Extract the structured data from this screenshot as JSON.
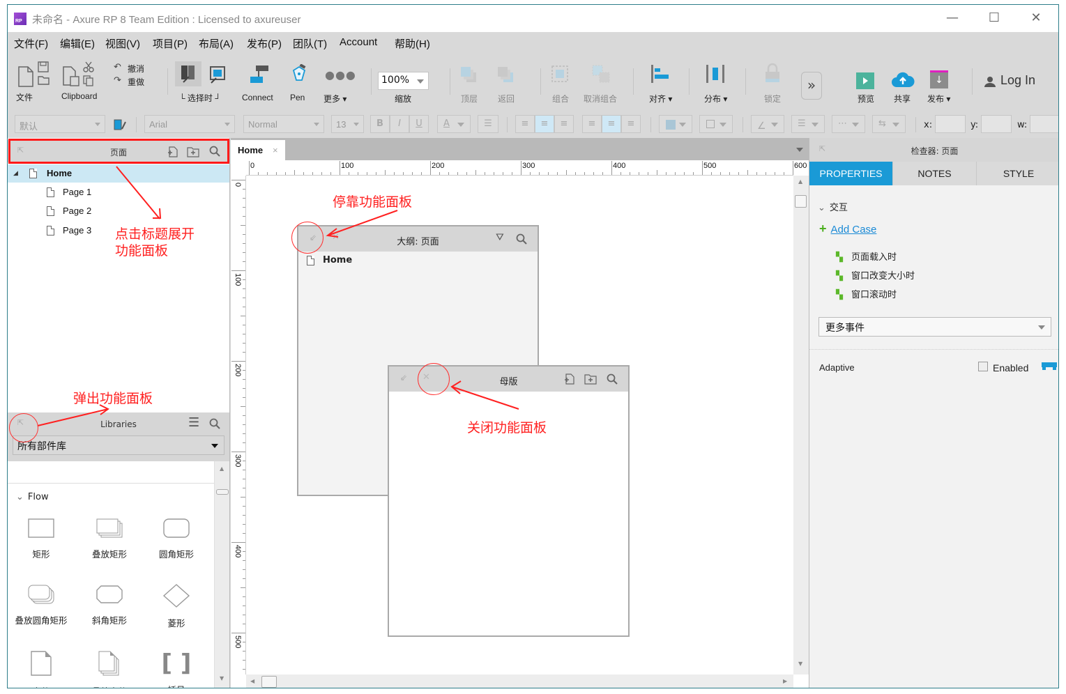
{
  "window": {
    "title": "未命名 - Axure RP 8 Team Edition : Licensed to axureuser",
    "logo_text": "RP",
    "controls": {
      "minimize": "—",
      "maximize": "☐",
      "close": "✕"
    }
  },
  "menu": [
    "文件(F)",
    "编辑(E)",
    "视图(V)",
    "项目(P)",
    "布局(A)",
    "发布(P)",
    "团队(T)",
    "Account",
    "帮助(H)"
  ],
  "toolbar": {
    "file_label": "文件",
    "clipboard_label": "Clipboard",
    "undo_label": "撤消",
    "redo_label": "重做",
    "select_mode_label": "选择时",
    "connect_label": "Connect",
    "pen_label": "Pen",
    "more_label": "更多 ▾",
    "zoom_value": "100%",
    "zoom_label": "缩放",
    "top_label": "顶层",
    "back_label": "返回",
    "group_label": "组合",
    "ungroup_label": "取消组合",
    "align_label": "对齐 ▾",
    "distribute_label": "分布 ▾",
    "lock_label": "锁定",
    "overflow_label": "»",
    "preview_label": "预览",
    "share_label": "共享",
    "publish_label": "发布 ▾",
    "login_label": "Log In",
    "colors": {
      "preview": "#4cb39c",
      "share": "#1a9ad6",
      "publish_bar": "#e020c0",
      "accent": "#1a9ad6"
    }
  },
  "format_bar": {
    "style_value": "默认",
    "font_value": "Arial",
    "weight_value": "Normal",
    "size_value": "13",
    "bold": "B",
    "italic": "I",
    "underline": "U",
    "font_color": "A",
    "x_label": "x:",
    "y_label": "y:",
    "w_label": "w:"
  },
  "pages_panel": {
    "title": "页面",
    "items": [
      {
        "label": "Home",
        "selected": true
      },
      {
        "label": "Page 1"
      },
      {
        "label": "Page 2"
      },
      {
        "label": "Page 3"
      }
    ]
  },
  "libraries_panel": {
    "title": "Libraries",
    "selected_library": "所有部件库",
    "group": "Flow",
    "widgets": [
      "矩形",
      "叠放矩形",
      "圆角矩形",
      "叠放圆角矩形",
      "斜角矩形",
      "菱形",
      "文件",
      "叠放文件",
      "括号"
    ]
  },
  "canvas": {
    "tab_label": "Home",
    "hruler_labels": [
      "0",
      "100",
      "200",
      "300",
      "400",
      "500",
      "600"
    ],
    "vruler_labels": [
      "0",
      "100",
      "200",
      "300",
      "400",
      "500"
    ]
  },
  "outline_panel": {
    "title": "大纲: 页面",
    "items": [
      "Home"
    ]
  },
  "masters_panel": {
    "title": "母版"
  },
  "annotations": {
    "expand": "点击标题展开\n功能面板",
    "expand_line1": "点击标题展开",
    "expand_line2": "功能面板",
    "dock": "停靠功能面板",
    "popout": "弹出功能面板",
    "close": "关闭功能面板",
    "color": "#ff2020"
  },
  "inspector": {
    "title": "检查器: 页面",
    "tabs": [
      "PROPERTIES",
      "NOTES",
      "STYLE"
    ],
    "active_tab": "PROPERTIES",
    "interactions_label": "交互",
    "add_case": "Add Case",
    "events": [
      "页面载入时",
      "窗口改变大小时",
      "窗口滚动时"
    ],
    "more_events": "更多事件",
    "adaptive_label": "Adaptive",
    "enabled_label": "Enabled",
    "enabled": false
  }
}
